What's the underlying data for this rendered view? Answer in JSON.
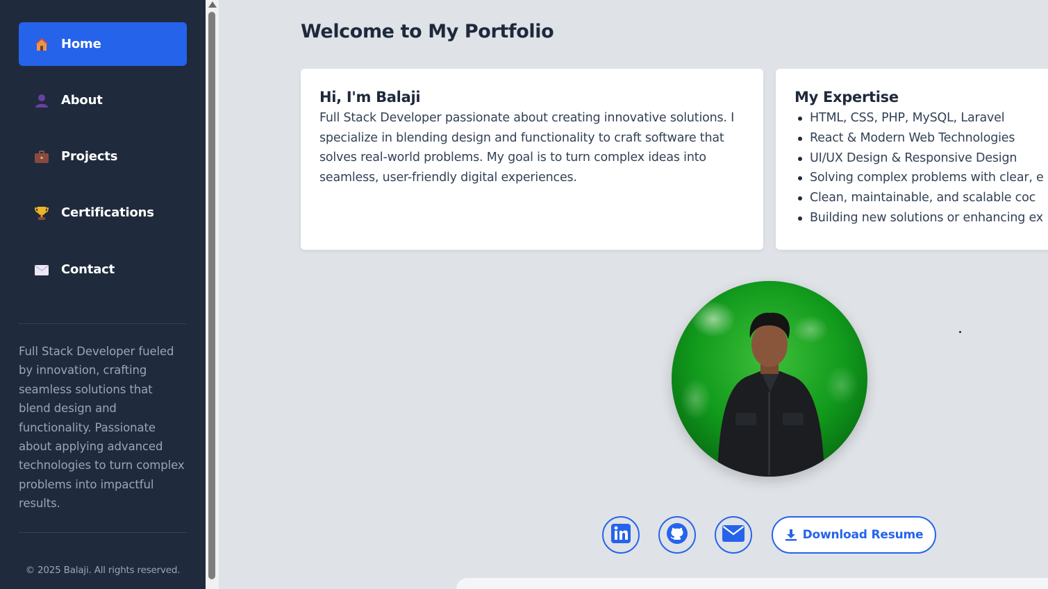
{
  "sidebar": {
    "nav": [
      {
        "label": "Home",
        "icon": "house-icon",
        "active": true
      },
      {
        "label": "About",
        "icon": "person-icon",
        "active": false
      },
      {
        "label": "Projects",
        "icon": "briefcase-icon",
        "active": false
      },
      {
        "label": "Certifications",
        "icon": "trophy-icon",
        "active": false
      },
      {
        "label": "Contact",
        "icon": "envelope-icon",
        "active": false
      }
    ],
    "description": "Full Stack Developer fueled by innovation, crafting seamless solutions that blend design and functionality. Passionate about applying advanced technologies to turn complex problems into impactful results.",
    "copyright": "© 2025 Balaji. All rights reserved."
  },
  "main": {
    "title": "Welcome to My Portfolio",
    "intro": {
      "heading": "Hi, I'm Balaji",
      "body": "Full Stack Developer passionate about creating innovative solutions. I specialize in blending design and functionality to craft software that solves real-world problems. My goal is to turn complex ideas into seamless, user-friendly digital experiences."
    },
    "expertise": {
      "heading": "My Expertise",
      "items": [
        "HTML, CSS, PHP, MySQL, Laravel",
        "React & Modern Web Technologies",
        "UI/UX Design & Responsive Design",
        "Solving complex problems with clear, e",
        "Clean, maintainable, and scalable coc",
        "Building new solutions or enhancing ex"
      ]
    },
    "social": [
      {
        "name": "linkedin-icon"
      },
      {
        "name": "github-icon"
      },
      {
        "name": "mail-icon"
      }
    ],
    "resume_label": "Download Resume"
  },
  "colors": {
    "accent": "#2563eb",
    "sidebar_bg": "#1f2a3c",
    "page_bg": "#dfe2e7"
  }
}
